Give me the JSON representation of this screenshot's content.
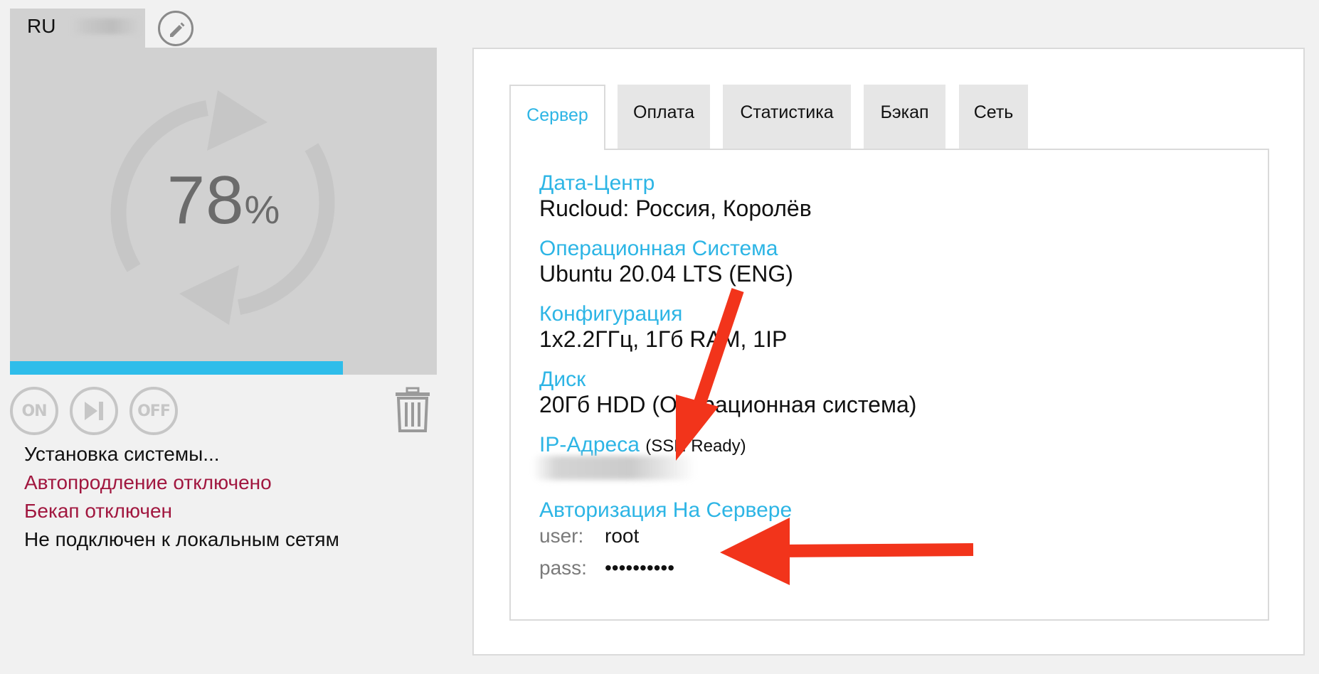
{
  "server": {
    "name": "RU",
    "progress_number": "78",
    "progress_symbol": "%",
    "progress_fraction": 0.78,
    "power": {
      "on_label": "ON",
      "off_label": "OFF"
    },
    "status": {
      "installing": "Установка системы...",
      "autorenew": "Автопродление отключено",
      "backup": "Бекап отключен",
      "network": "Не подключен к локальным сетям"
    }
  },
  "tabs": [
    {
      "label": "Сервер",
      "active": true
    },
    {
      "label": "Оплата",
      "active": false
    },
    {
      "label": "Статистика",
      "active": false
    },
    {
      "label": "Бэкап",
      "active": false
    },
    {
      "label": "Сеть",
      "active": false
    }
  ],
  "details": {
    "datacenter": {
      "label": "Дата-Центр",
      "value": "Rucloud: Россия, Королёв"
    },
    "os": {
      "label": "Операционная Система",
      "value": "Ubuntu 20.04 LTS (ENG)"
    },
    "config": {
      "label": "Конфигурация",
      "value": "1x2.2ГГц, 1Гб RAM, 1IP"
    },
    "disk": {
      "label": "Диск",
      "value": "20Гб HDD (Операционная система)"
    },
    "ip": {
      "label": "IP-Адреса",
      "note": "(SSH Ready)"
    },
    "auth": {
      "label": "Авторизация На Сервере",
      "user_label": "user:",
      "user_value": "root",
      "pass_label": "pass:",
      "pass_value": "••••••••••"
    }
  },
  "colors": {
    "accent_blue": "#2db5e5",
    "progress_blue": "#2fbdea",
    "warning_red": "#a1173f",
    "arrow_red": "#f2341b"
  },
  "icons": {
    "edit": "pencil-icon",
    "spinner": "refresh-icon",
    "restart": "skip-next-icon",
    "delete": "trash-icon"
  }
}
